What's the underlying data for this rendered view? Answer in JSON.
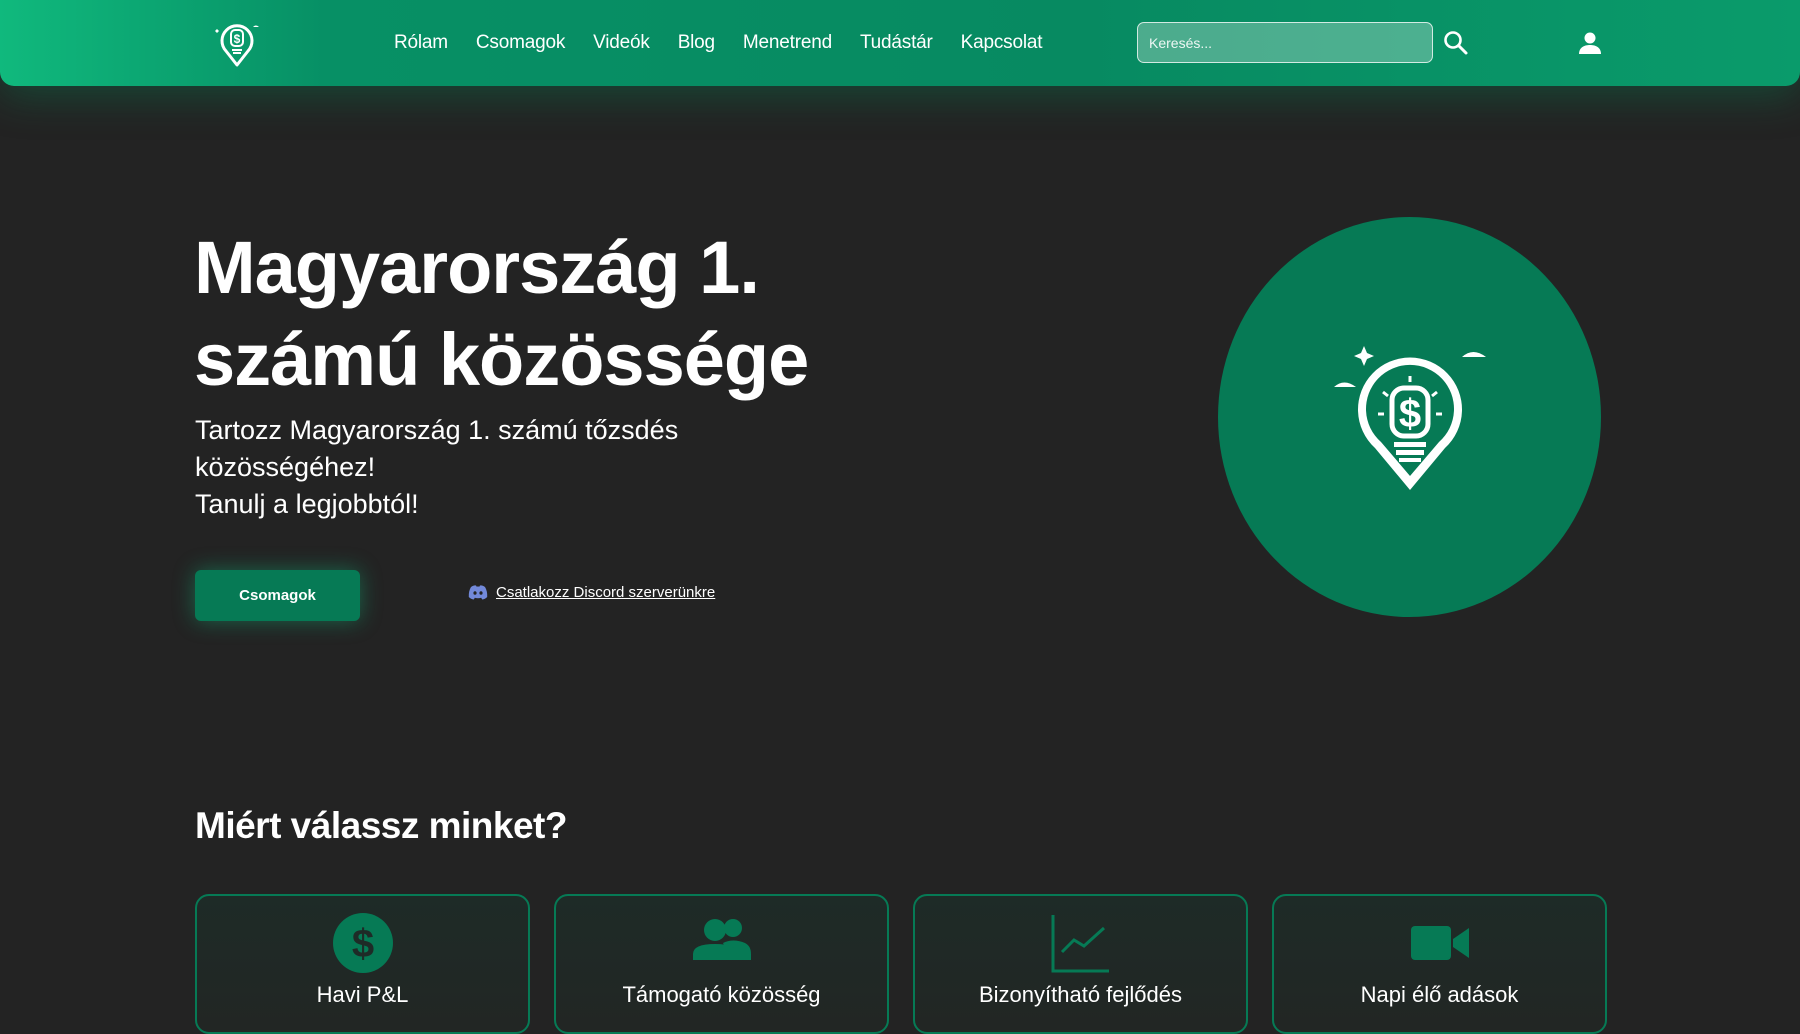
{
  "colors": {
    "brand": "#067a55",
    "brand_light": "#10b97d",
    "background": "#232323",
    "discord": "#7289da"
  },
  "header": {
    "logo_icon": "dollar-location-pin-icon",
    "nav": [
      {
        "label": "Rólam"
      },
      {
        "label": "Csomagok"
      },
      {
        "label": "Videók"
      },
      {
        "label": "Blog"
      },
      {
        "label": "Menetrend"
      },
      {
        "label": "Tudástár"
      },
      {
        "label": "Kapcsolat"
      }
    ],
    "search": {
      "placeholder": "Keresés...",
      "value": "",
      "icon": "search-icon"
    },
    "user_icon": "user-icon"
  },
  "hero": {
    "title_line1": "Magyarország 1.",
    "title_line2": "számú közössége",
    "subtitle_line1": "Tartozz Magyarország 1. számú tőzsdés",
    "subtitle_line2": "közösségéhez!",
    "subtitle_line3": "Tanulj a legjobbtól!",
    "cta_label": "Csomagok",
    "discord_label": "Csatlakozz Discord szerverünkre",
    "emblem_icon": "dollar-location-pin-icon"
  },
  "why": {
    "title": "Miért válassz minket?",
    "features": [
      {
        "title": "Havi P&L",
        "icon": "dollar-icon"
      },
      {
        "title": "Támogató közösség",
        "icon": "users-icon"
      },
      {
        "title": "Bizonyítható fejlődés",
        "icon": "chart-line-icon"
      },
      {
        "title": "Napi élő adások",
        "icon": "video-camera-icon"
      }
    ]
  }
}
